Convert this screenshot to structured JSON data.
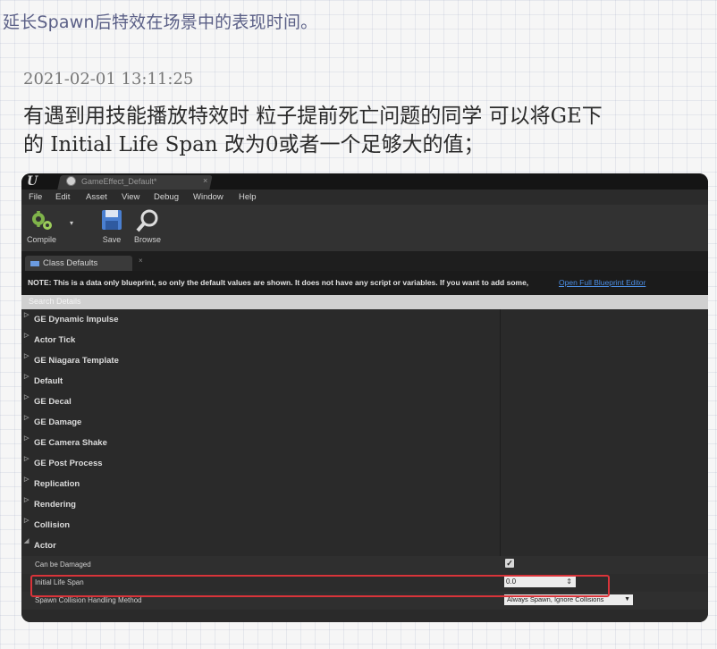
{
  "header": {
    "top_line": "延长Spawn后特效在场景中的表现时间。",
    "timestamp": "2021-02-01 13:11:25",
    "comment_line1": "有遇到用技能播放特效时 粒子提前死亡问题的同学 可以将GE下",
    "comment_line2": "的 Initial Life Span 改为0或者一个足够大的值；"
  },
  "editor": {
    "logo": "U",
    "doc_tab": "GameEffect_Default*",
    "doc_tab_close": "×",
    "menu": [
      "File",
      "Edit",
      "Asset",
      "View",
      "Debug",
      "Window",
      "Help"
    ],
    "toolbar": {
      "compile": "Compile",
      "save": "Save",
      "browse": "Browse"
    },
    "panel_tab": "Class Defaults",
    "panel_tab_close": "×",
    "note": "NOTE: This is a data only blueprint, so only the default values are shown.  It does not have any script or variables.  If you want to add some,",
    "note_link": "Open Full Blueprint Editor",
    "search_placeholder": "Search Details",
    "categories": [
      "GE Dynamic Impulse",
      "Actor Tick",
      "GE Niagara Template",
      "Default",
      "GE Decal",
      "GE Damage",
      "GE Camera Shake",
      "GE Post Process",
      "Replication",
      "Rendering",
      "Collision",
      "Actor"
    ],
    "properties": {
      "can_be_damaged": "Can be Damaged",
      "can_be_damaged_value": true,
      "initial_life_span": "Initial Life Span",
      "initial_life_span_value": "0.0",
      "spawn_collision": "Spawn Collision Handling Method",
      "spawn_collision_value": "Always Spawn, Ignore Collisions"
    },
    "colors": {
      "highlight_border": "#d9343a",
      "link": "#4c8fe6"
    }
  }
}
